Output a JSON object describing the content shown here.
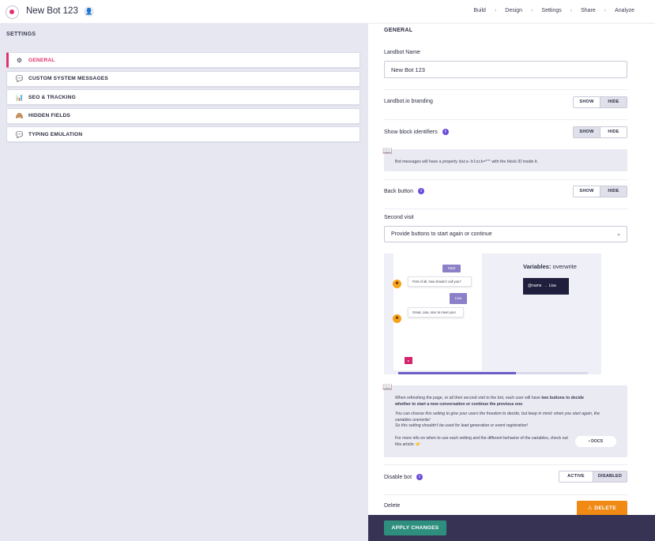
{
  "header": {
    "bot_title": "New Bot 123",
    "nav": [
      "Build",
      "Design",
      "Settings",
      "Share",
      "Analyze"
    ],
    "nav_separator": "›"
  },
  "sidebar": {
    "title": "SETTINGS",
    "items": [
      {
        "label": "GENERAL",
        "icon": "⚙",
        "active": true
      },
      {
        "label": "CUSTOM SYSTEM MESSAGES",
        "icon": "💬",
        "active": false
      },
      {
        "label": "SEO & TRACKING",
        "icon": "📊",
        "active": false
      },
      {
        "label": "HIDDEN FIELDS",
        "icon": "🙈",
        "active": false
      },
      {
        "label": "TYPING EMULATION",
        "icon": "💬",
        "active": false
      }
    ]
  },
  "general": {
    "section_title": "GENERAL",
    "name_label": "Landbot Name",
    "name_value": "New Bot 123",
    "branding_label": "Landbot.io branding",
    "branding_show": "SHOW",
    "branding_hide": "HIDE",
    "block_ids_label": "Show block identifiers",
    "block_ids_show": "SHOW",
    "block_ids_hide": "HIDE",
    "block_ids_note_pre": "Bot messages will have a property ",
    "block_ids_note_code": "data-block=\"\"",
    "block_ids_note_post": " with the block ID inside it.",
    "back_label": "Back button",
    "back_show": "SHOW",
    "back_hide": "HIDE",
    "second_visit_label": "Second visit",
    "second_visit_value": "Provide buttons to start again or continue",
    "preview": {
      "bubble_top": "Start",
      "bot_msg_1": "First of all, how should I call you?",
      "user_msg": "Lisa",
      "bot_msg_2": "Great, Lisa, nice to meet you!",
      "vars_bold": "Variables:",
      "vars_rest": " overwrite",
      "var_name": "@name",
      "var_arrow": "→",
      "var_value": "Lisa",
      "progress": 0.62
    },
    "note_line1_pre": "When refreshing the page, or all their second visit to the bot, each user will have ",
    "note_line1_bold": "two buttons to decide whether to start a new conversation or continue the previous one",
    "note_line1_post": ".",
    "note_italic_1": "You can choose this setting to give your users the freedom to decide, but keep in mind: when you start again, the variables overwrite!",
    "note_italic_2": "So this setting shouldn't be used for lead generation or event registration!",
    "note_more": "For more info on when to use each setting and the different behavior of the variables, check out this article:",
    "note_more_emoji": "👉",
    "docs_label": "DOCS",
    "disable_label": "Disable bot",
    "disable_active": "ACTIVE",
    "disable_disabled": "DISABLED",
    "delete_label": "Delete",
    "delete_button": "DELETE"
  },
  "footer": {
    "apply_label": "APPLY CHANGES"
  }
}
